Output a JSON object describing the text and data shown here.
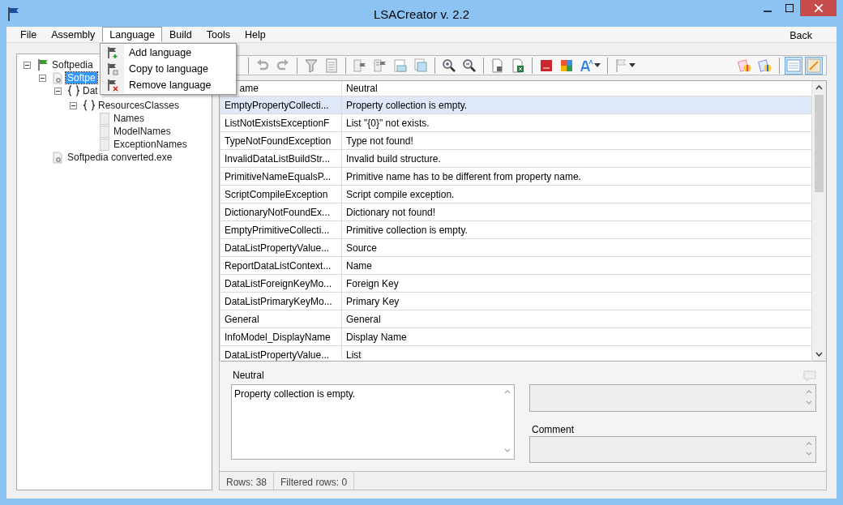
{
  "window": {
    "title": "LSACreator v. 2.2"
  },
  "menu": [
    {
      "label": "File",
      "selected": false
    },
    {
      "label": "Assembly",
      "selected": false
    },
    {
      "label": "Language",
      "selected": true
    },
    {
      "label": "Build",
      "selected": false
    },
    {
      "label": "Tools",
      "selected": false
    },
    {
      "label": "Help",
      "selected": false
    }
  ],
  "back_button": "Back",
  "dropdown": [
    {
      "label": "Add language",
      "kind": "add"
    },
    {
      "label": "Copy to language",
      "kind": "copy"
    },
    {
      "label": "Remove language",
      "kind": "remove"
    }
  ],
  "tree": [
    {
      "label": "Softpedia",
      "kind": "flag",
      "expanded": true,
      "selected": false,
      "children": [
        {
          "label": "Softpe",
          "kind": "assembly",
          "expanded": true,
          "selected": true,
          "children": [
            {
              "label": "Dat",
              "kind": "namespace",
              "expanded": true,
              "selected": false,
              "children": [
                {
                  "label": "ResourcesClasses",
                  "kind": "namespace",
                  "expanded": true,
                  "selected": false,
                  "children": [
                    {
                      "label": "Names",
                      "kind": "class",
                      "selected": false
                    },
                    {
                      "label": "ModelNames",
                      "kind": "class",
                      "selected": false
                    },
                    {
                      "label": "ExceptionNames",
                      "kind": "class",
                      "selected": false
                    }
                  ]
                }
              ]
            }
          ]
        },
        {
          "label": "Softpedia converted.exe",
          "kind": "assembly",
          "selected": false
        }
      ]
    }
  ],
  "toolbar_toggles": [
    {
      "kind": "grid",
      "selected": true
    },
    {
      "kind": "edit",
      "selected": true
    }
  ],
  "table": {
    "columns": [
      "ame",
      "Neutral"
    ],
    "rows": [
      {
        "cells": [
          "EmptyPropertyCollecti...",
          "Property collection is empty."
        ],
        "selected": true
      },
      {
        "cells": [
          "ListNotExistsExceptionF",
          "List \"{0}\" not exists."
        ],
        "selected": false
      },
      {
        "cells": [
          "TypeNotFoundException",
          "Type not found!"
        ],
        "selected": false
      },
      {
        "cells": [
          "InvalidDataListBuildStr...",
          "Invalid build structure."
        ],
        "selected": false
      },
      {
        "cells": [
          "PrimitiveNameEqualsP...",
          "Primitive name has to be different from property name."
        ],
        "selected": false
      },
      {
        "cells": [
          "ScriptCompileException",
          "Script compile exception."
        ],
        "selected": false
      },
      {
        "cells": [
          "DictionaryNotFoundEx...",
          "Dictionary not found!"
        ],
        "selected": false
      },
      {
        "cells": [
          "EmptyPrimitiveCollecti...",
          "Primitive collection is empty."
        ],
        "selected": false
      },
      {
        "cells": [
          "DataListPropertyValue...",
          "Source"
        ],
        "selected": false
      },
      {
        "cells": [
          "ReportDataListContext...",
          "Name"
        ],
        "selected": false
      },
      {
        "cells": [
          "DataListForeignKeyMo...",
          "Foreign Key"
        ],
        "selected": false
      },
      {
        "cells": [
          "DataListPrimaryKeyMo...",
          "Primary Key"
        ],
        "selected": false
      },
      {
        "cells": [
          "General",
          "General"
        ],
        "selected": false
      },
      {
        "cells": [
          "InfoModel_DisplayName",
          "Display Name"
        ],
        "selected": false
      },
      {
        "cells": [
          "DataListPropertyValue...",
          "List"
        ],
        "selected": false
      }
    ]
  },
  "detail": {
    "neutral_label": "Neutral",
    "neutral_value": "Property collection is empty.",
    "comment_label": "Comment"
  },
  "status_bar": [
    "Rows:  38",
    "Filtered rows:  0"
  ]
}
